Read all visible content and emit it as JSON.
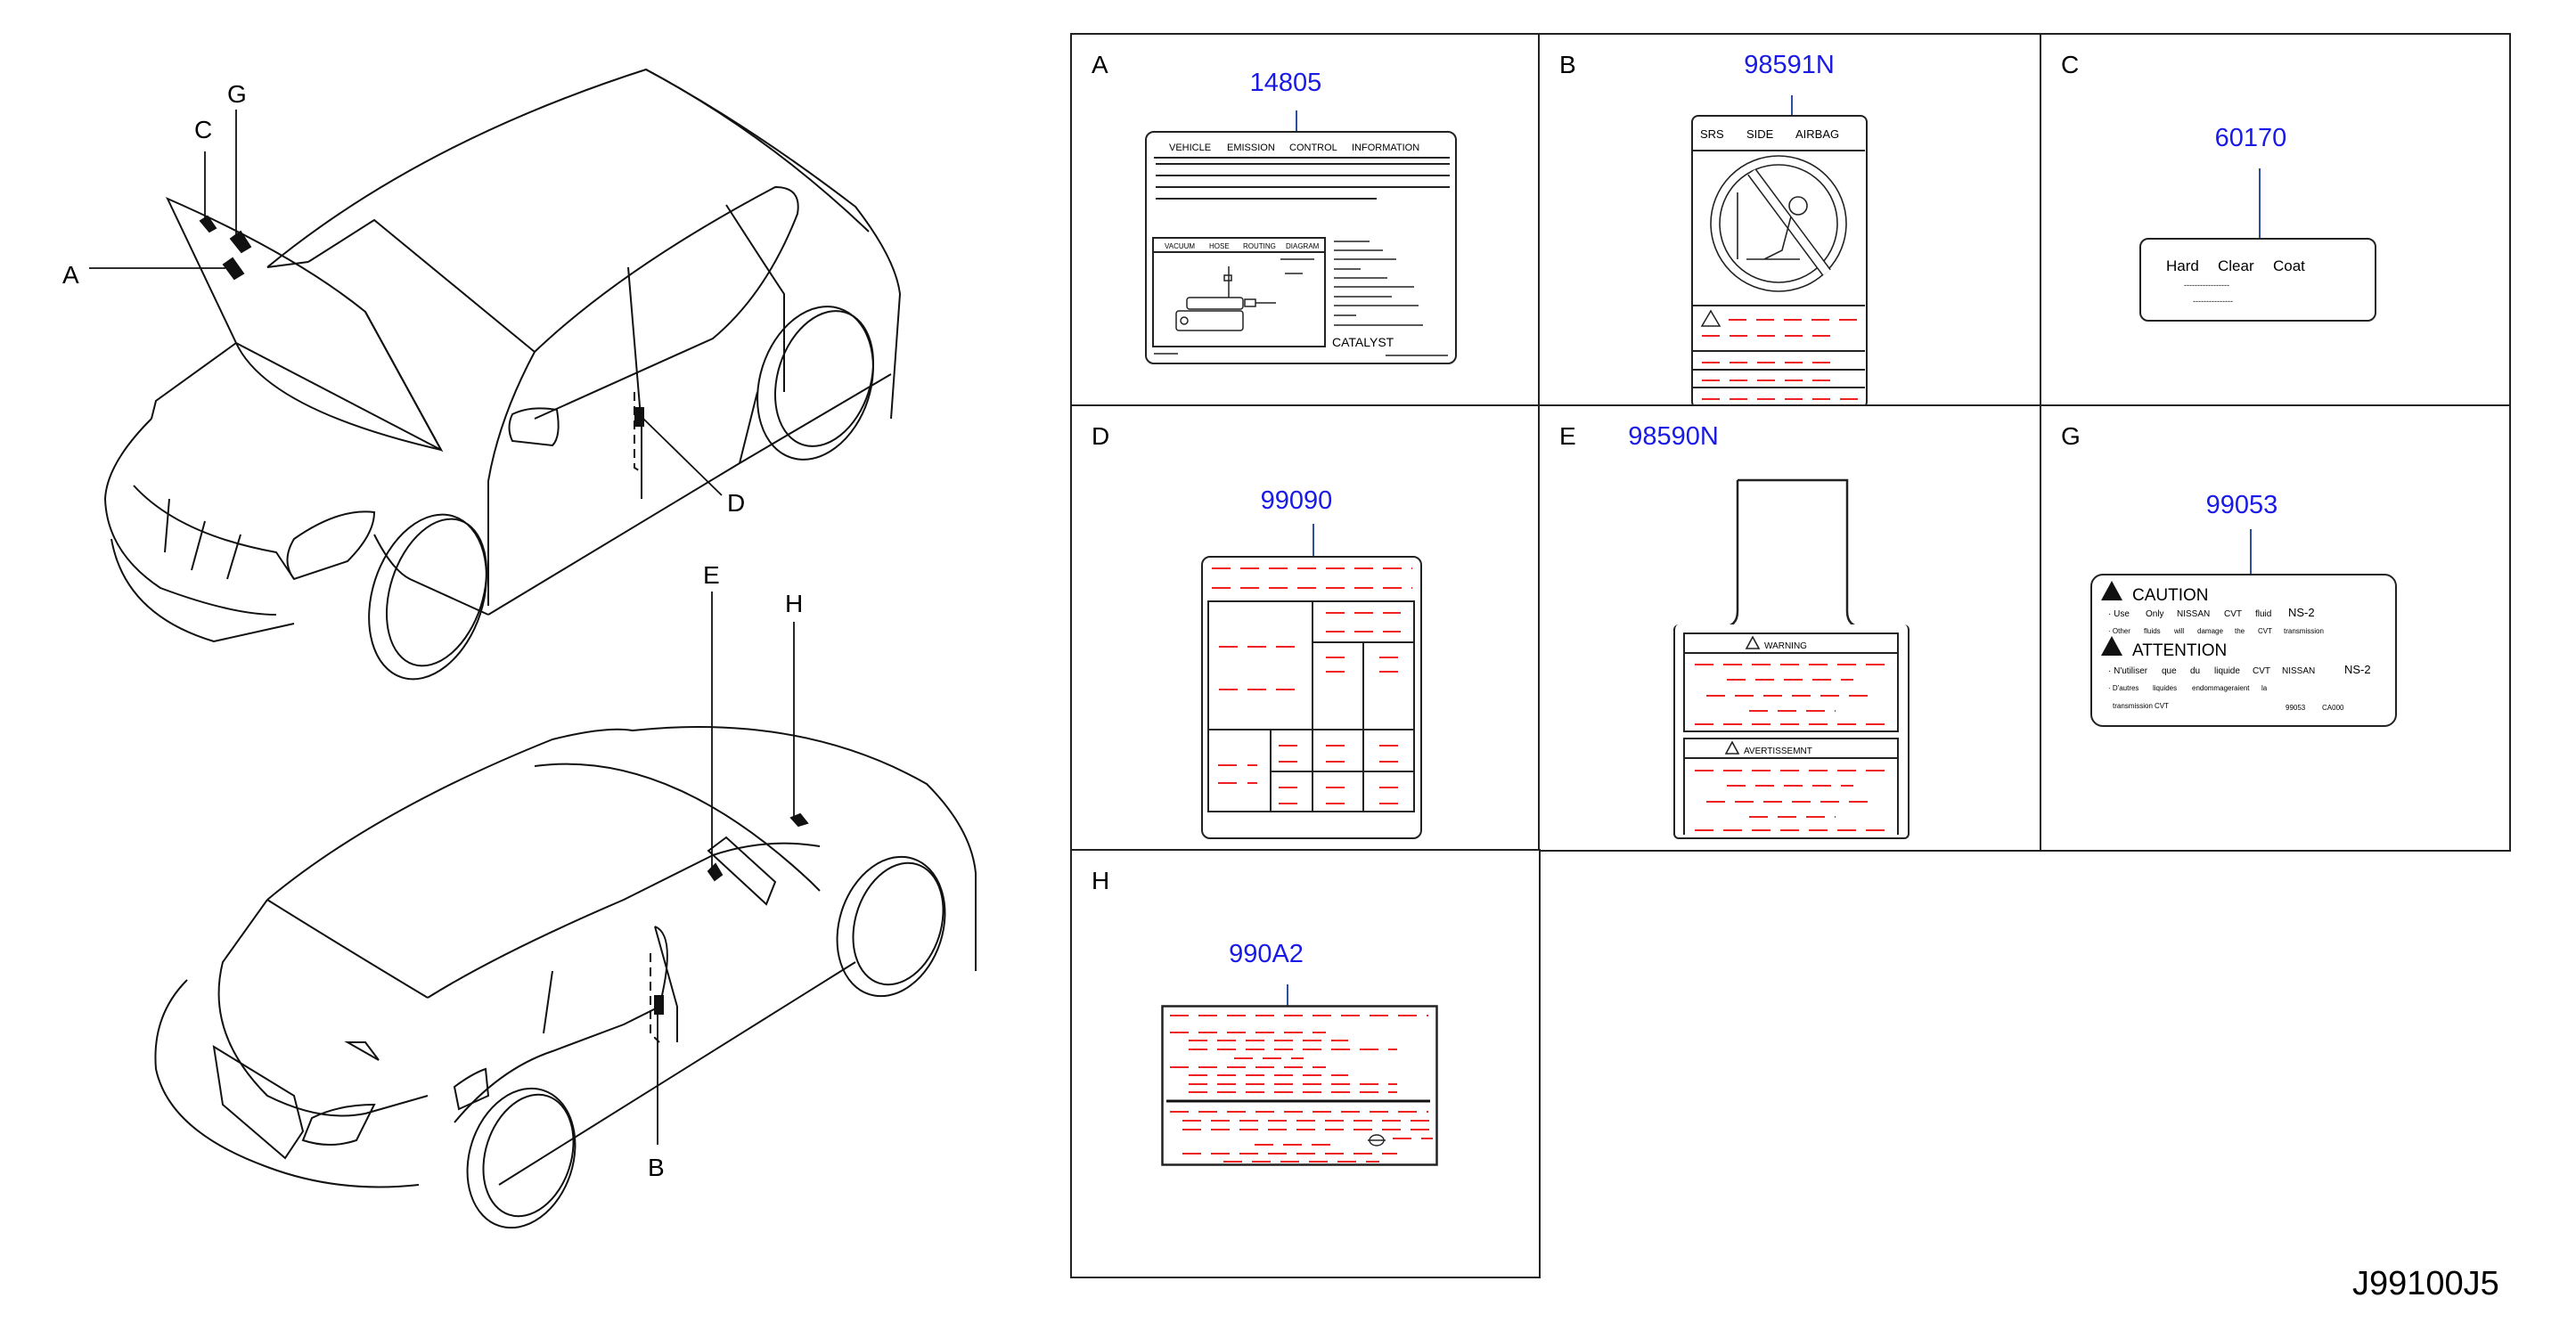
{
  "drawing_number": "J99100J5",
  "colors": {
    "part_number": "#1a1ae6",
    "leader": "#2c4fa0",
    "placeholder_text": "#ee2222",
    "line": "#222222"
  },
  "callouts": {
    "front_car": [
      "A",
      "C",
      "G",
      "D"
    ],
    "rear_car": [
      "E",
      "H",
      "B"
    ]
  },
  "panels": [
    {
      "letter": "A",
      "part_number": "14805",
      "label_type": "vehicle-emission-control-information",
      "text": {
        "title_words": [
          "VEHICLE",
          "EMISSION",
          "CONTROL",
          "INFORMATION"
        ],
        "diagram_words": [
          "VACUUM",
          "HOSE",
          "ROUTING",
          "DIAGRAM"
        ],
        "catalyst": "CATALYST"
      }
    },
    {
      "letter": "B",
      "part_number": "98591N",
      "label_type": "srs-side-airbag-warning",
      "text": {
        "title_words": [
          "SRS",
          "SIDE",
          "AIRBAG"
        ]
      }
    },
    {
      "letter": "C",
      "part_number": "60170",
      "label_type": "hard-clear-coat",
      "text": {
        "title_words": [
          "Hard",
          "Clear",
          "Coat"
        ],
        "line1": "-----------------",
        "line2": "---------------"
      }
    },
    {
      "letter": "D",
      "part_number": "99090",
      "label_type": "tire-information-placard"
    },
    {
      "letter": "E",
      "part_number": "98590N",
      "label_type": "airbag-sun-visor-warning",
      "text": {
        "warning": "WARNING",
        "avertissement": "AVERTISSEMNT"
      }
    },
    {
      "letter": "G",
      "part_number": "99053",
      "label_type": "cvt-fluid-caution",
      "text": {
        "caution": "CAUTION",
        "en_line1": [
          "· Use",
          "Only",
          "NISSAN",
          "CVT",
          "fluid"
        ],
        "en_line1_code": "NS-2",
        "en_line2": [
          "· Other",
          "fluids",
          "will",
          "damage",
          "the",
          "CVT",
          "transmission"
        ],
        "attention": "ATTENTION",
        "fr_line1": [
          "· N'utiliser",
          "que",
          "du",
          "liquide",
          "CVT",
          "NISSAN"
        ],
        "fr_line1_code": "NS-2",
        "fr_line2": [
          "· D'autres",
          "liquides",
          "endommageraient",
          "la"
        ],
        "fr_line3": [
          "transmission",
          "CVT"
        ],
        "code": [
          "99053",
          "CA000"
        ]
      }
    },
    {
      "letter": "H",
      "part_number": "990A2",
      "label_type": "tire-pressure-emblem-label"
    }
  ]
}
